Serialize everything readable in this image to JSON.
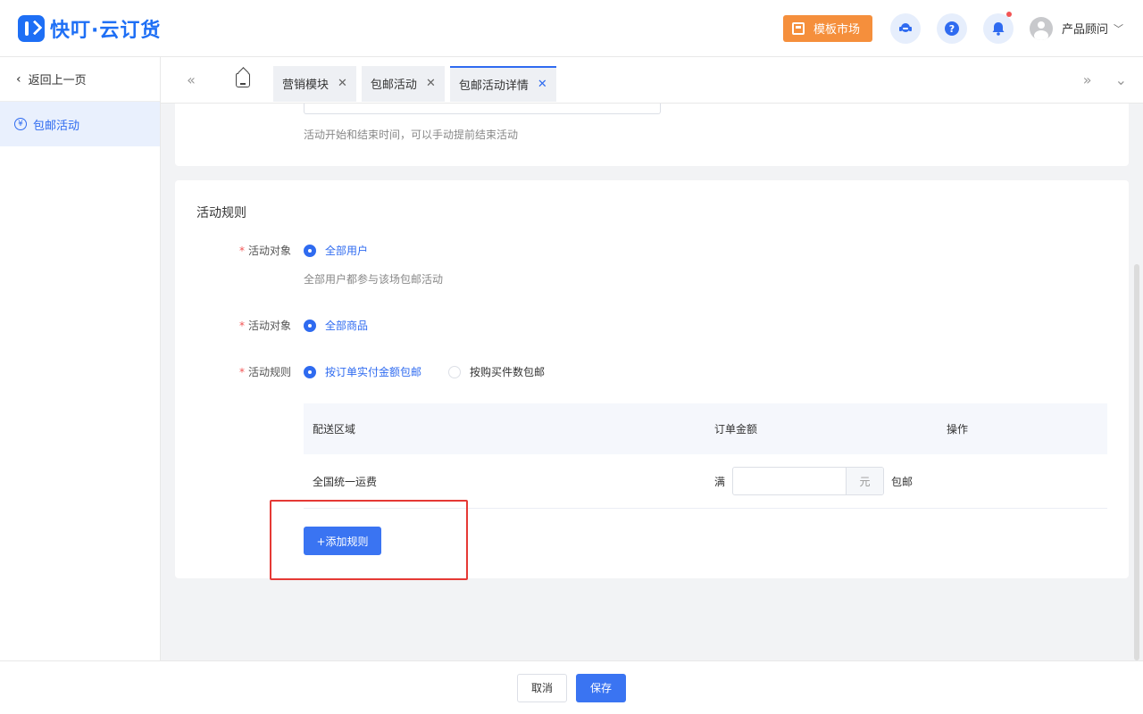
{
  "header": {
    "logo_text": "快叮·云订货",
    "market_label": "模板市场",
    "user_name": "产品顾问",
    "icons": [
      "service-icon",
      "help-icon",
      "bell-icon",
      "avatar",
      "chevron-down-icon"
    ]
  },
  "sidebar": {
    "back_label": "返回上一页",
    "items": [
      {
        "label": "包邮活动",
        "active": true
      }
    ]
  },
  "tabs": [
    {
      "label": "营销模块",
      "active": false
    },
    {
      "label": "包邮活动",
      "active": false
    },
    {
      "label": "包邮活动详情",
      "active": true
    }
  ],
  "card1": {
    "hint": "活动开始和结束时间，可以手动提前结束活动"
  },
  "rules": {
    "title": "活动规则",
    "target_user_label": "活动对象",
    "target_user_option": "全部用户",
    "target_user_hint": "全部用户都参与该场包邮活动",
    "target_goods_label": "活动对象",
    "target_goods_option": "全部商品",
    "rule_label": "活动规则",
    "rule_option_1": "按订单实付金额包邮",
    "rule_option_2": "按购买件数包邮",
    "table": {
      "headers": [
        "配送区域",
        "订单金额",
        "操作"
      ],
      "rows": [
        {
          "region": "全国统一运费",
          "prefix": "满",
          "unit": "元",
          "suffix": "包邮"
        }
      ]
    },
    "add_rule_label": "+添加规则"
  },
  "footer": {
    "cancel_label": "取消",
    "save_label": "保存"
  },
  "colors": {
    "primary": "#3a74f2",
    "market": "#f58f3c",
    "highlight": "#e53935"
  }
}
